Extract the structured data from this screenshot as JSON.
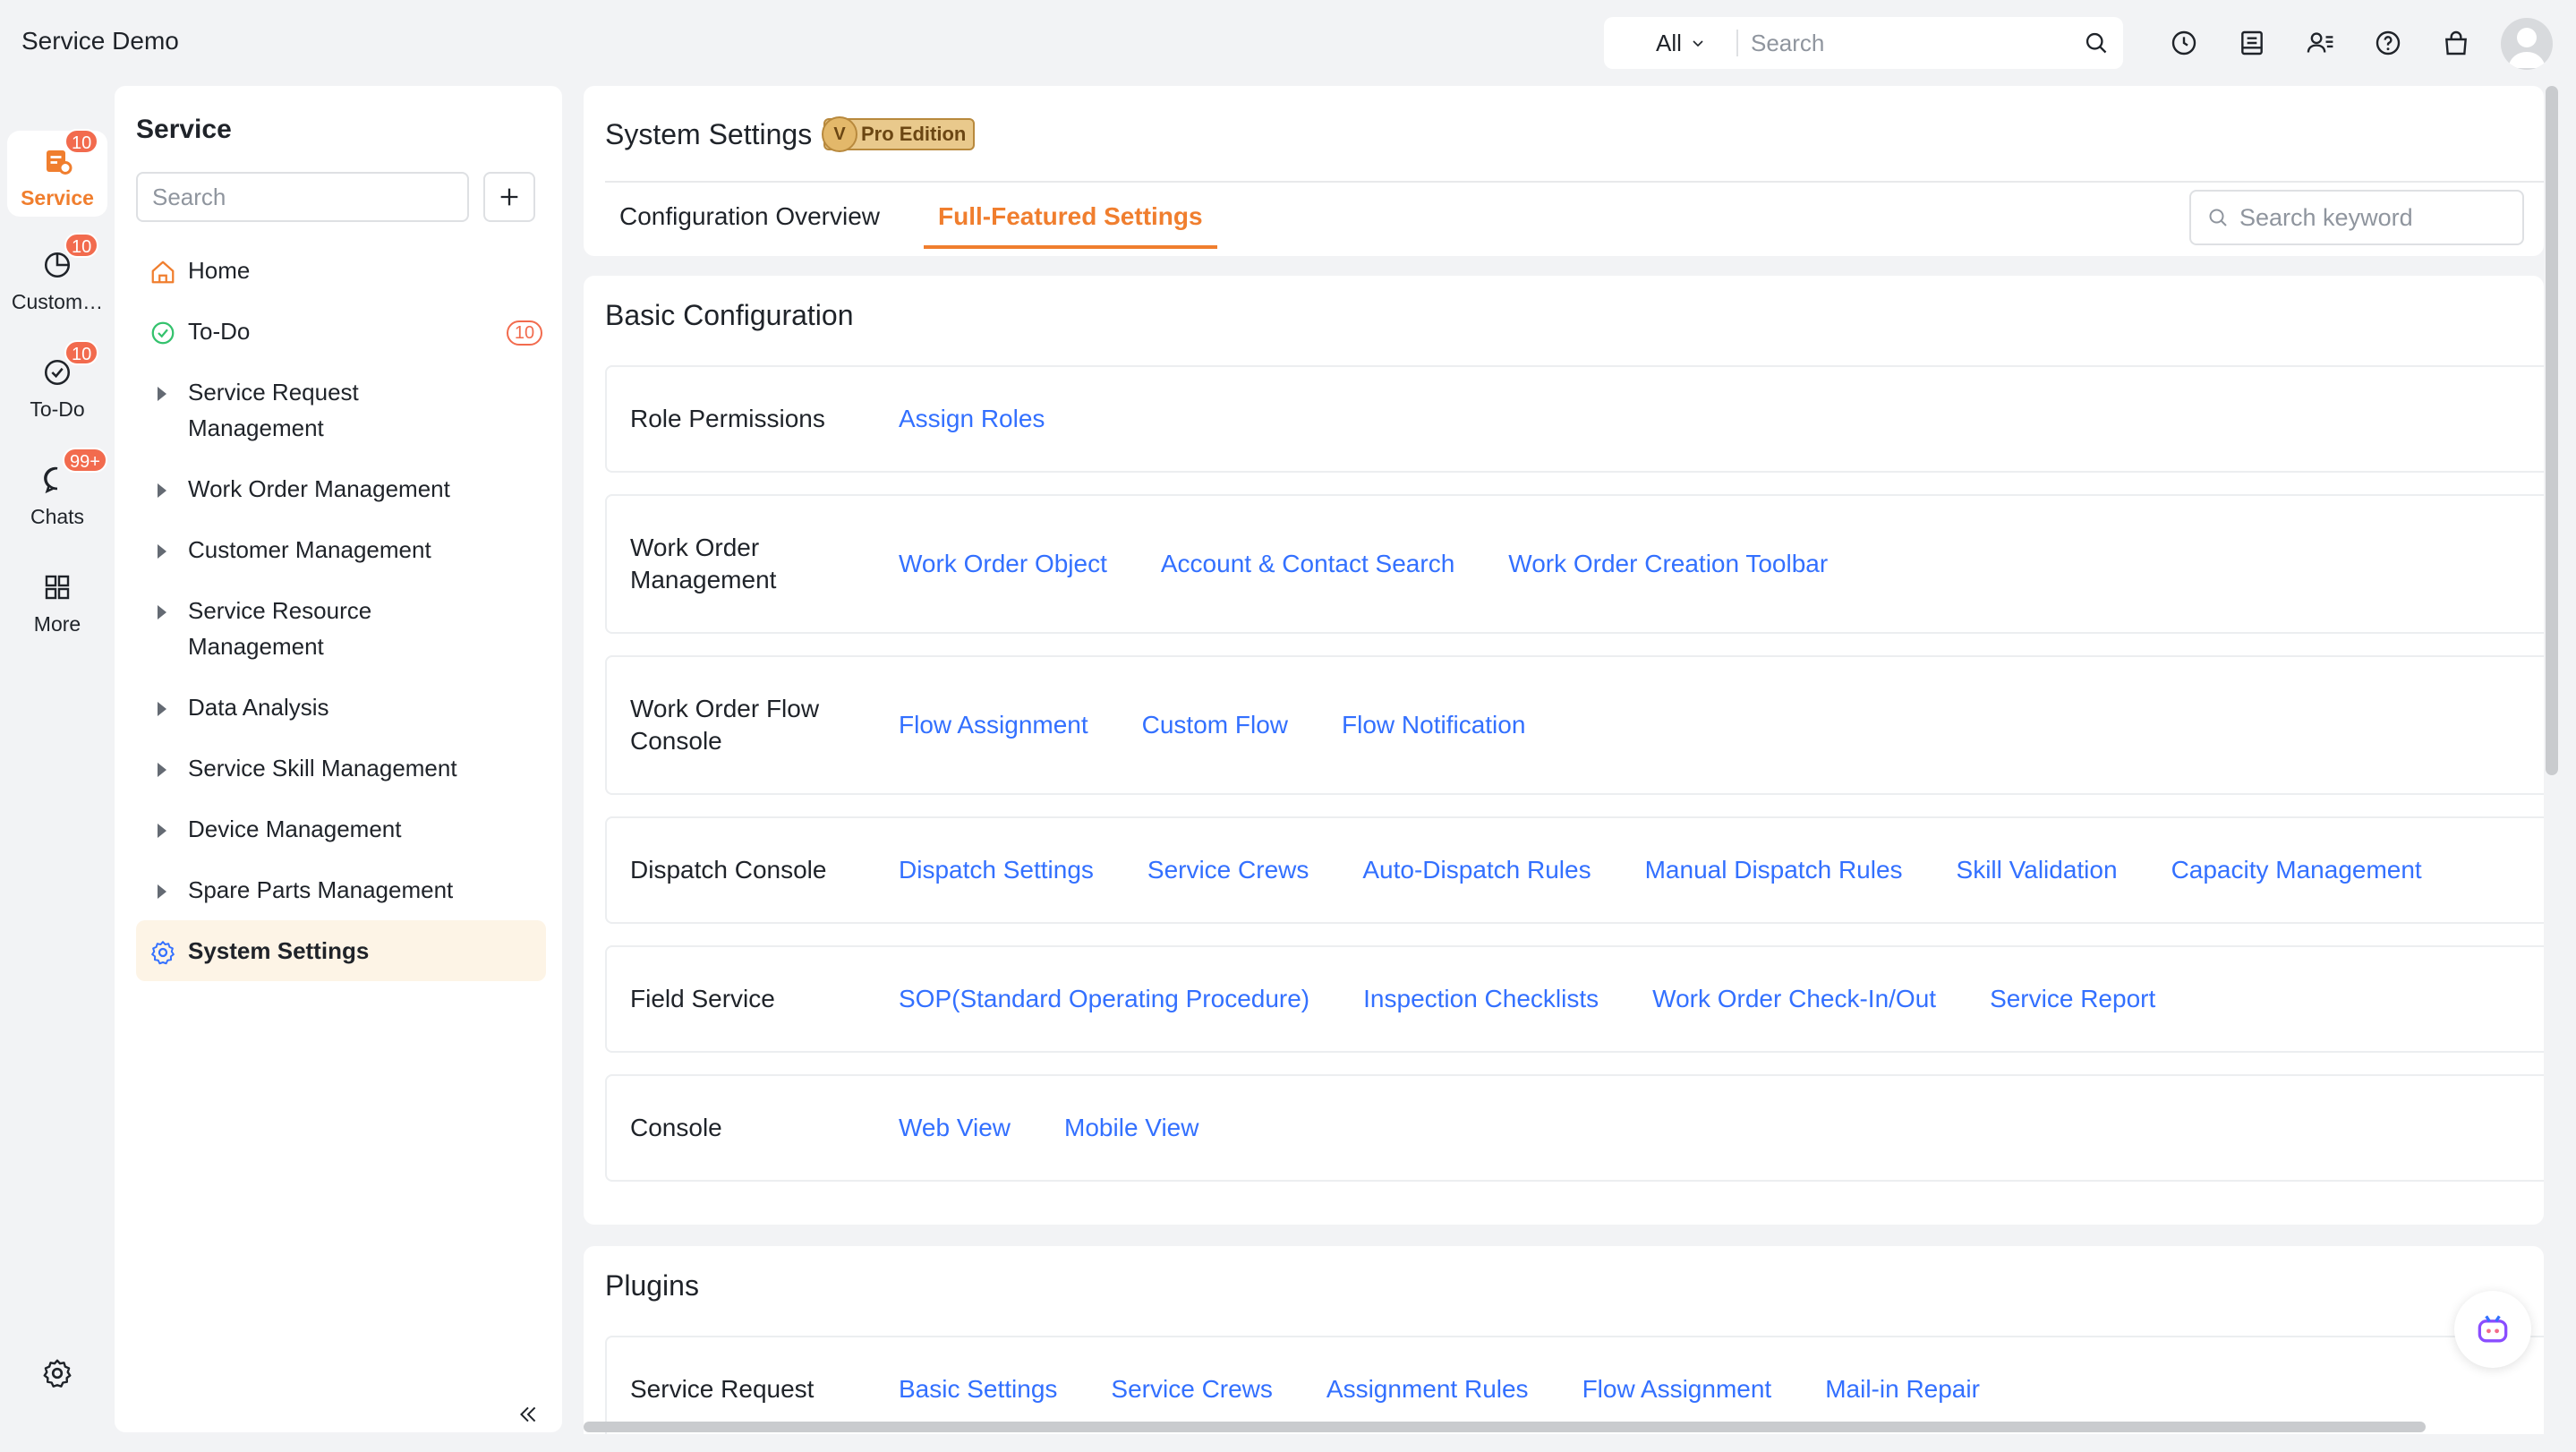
{
  "app": {
    "title": "Service Demo"
  },
  "global_search": {
    "scope": "All",
    "placeholder": "Search"
  },
  "rail": [
    {
      "label": "Service",
      "badge": "10",
      "icon": "service-icon",
      "active": true
    },
    {
      "label": "Custom…",
      "badge": "10",
      "icon": "pie-chart-icon"
    },
    {
      "label": "To-Do",
      "badge": "10",
      "icon": "check-circle-icon"
    },
    {
      "label": "Chats",
      "badge": "99+",
      "icon": "chat-bubble-icon"
    },
    {
      "label": "More",
      "badge": "",
      "icon": "grid-icon"
    }
  ],
  "sidebar": {
    "title": "Service",
    "search_placeholder": "Search",
    "items": [
      {
        "label": "Home"
      },
      {
        "label": "To-Do",
        "badge": "10"
      },
      {
        "label": "Service Request Management"
      },
      {
        "label": "Work Order Management"
      },
      {
        "label": "Customer Management"
      },
      {
        "label": "Service Resource Management"
      },
      {
        "label": "Data Analysis"
      },
      {
        "label": "Service Skill Management"
      },
      {
        "label": "Device Management"
      },
      {
        "label": "Spare Parts Management"
      },
      {
        "label": "System Settings"
      }
    ]
  },
  "header": {
    "title": "System Settings",
    "edition": "Pro Edition",
    "edition_mark": "V",
    "tabs": [
      "Configuration Overview",
      "Full-Featured Settings"
    ],
    "keyword_placeholder": "Search keyword"
  },
  "basic": {
    "title": "Basic Configuration",
    "rows": [
      {
        "label": "Role Permissions",
        "links": [
          "Assign Roles"
        ]
      },
      {
        "label": "Work Order Management",
        "links": [
          "Work Order Object",
          "Account & Contact Search",
          "Work Order Creation Toolbar"
        ]
      },
      {
        "label": "Work Order Flow Console",
        "links": [
          "Flow Assignment",
          "Custom Flow",
          "Flow Notification"
        ]
      },
      {
        "label": "Dispatch Console",
        "links": [
          "Dispatch Settings",
          "Service Crews",
          "Auto-Dispatch Rules",
          "Manual Dispatch Rules",
          "Skill Validation",
          "Capacity Management"
        ]
      },
      {
        "label": "Field Service",
        "links": [
          "SOP(Standard Operating Procedure)",
          "Inspection Checklists",
          "Work Order Check-In/Out",
          "Service Report"
        ]
      },
      {
        "label": "Console",
        "links": [
          "Web View",
          "Mobile View"
        ]
      }
    ]
  },
  "plugins": {
    "title": "Plugins",
    "rows": [
      {
        "label": "Service Request",
        "links": [
          "Basic Settings",
          "Service Crews",
          "Assignment Rules",
          "Flow Assignment",
          "Mail-in Repair"
        ]
      }
    ]
  },
  "colors": {
    "accent": "#f07e2e",
    "link": "#3370ff",
    "badge": "#f26b4e",
    "active_bg": "#fdf4e6"
  }
}
